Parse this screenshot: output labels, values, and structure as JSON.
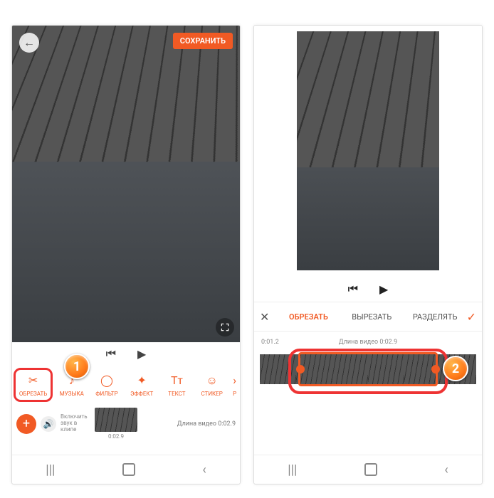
{
  "badges": {
    "one": "1",
    "two": "2"
  },
  "left": {
    "save_label": "СОХРАНИТЬ",
    "tools": {
      "crop": "ОБРЕЗАТЬ",
      "music": "МУЗЫКА",
      "filter": "ФИЛЬТР",
      "effect": "ЭФФЕКТ",
      "text": "ТЕКСТ",
      "sticker": "СТИКЕР",
      "more": "Р"
    },
    "sound_toggle": "Включить звук в клипе",
    "clip_time": "0:02.9",
    "video_length": "Длина видео 0:02.9"
  },
  "right": {
    "tabs": {
      "crop": "ОБРЕЗАТЬ",
      "cut": "ВЫРЕЗАТЬ",
      "split": "РАЗДЕЛЯТЬ"
    },
    "time_left": "0:01.2",
    "time_center": "Длина видео 0:02.9",
    "time_right": ""
  },
  "icons": {
    "back": "←",
    "prev": "⏮",
    "play": "▶",
    "scissors": "✂",
    "music": "♪",
    "filter": "◯",
    "effect": "✦",
    "text": "Tᴛ",
    "sticker": "☺",
    "chevron": "›",
    "plus": "+",
    "speaker": "🔊",
    "close": "✕",
    "check": "✓",
    "nav_recent": "|||",
    "nav_back": "‹"
  }
}
